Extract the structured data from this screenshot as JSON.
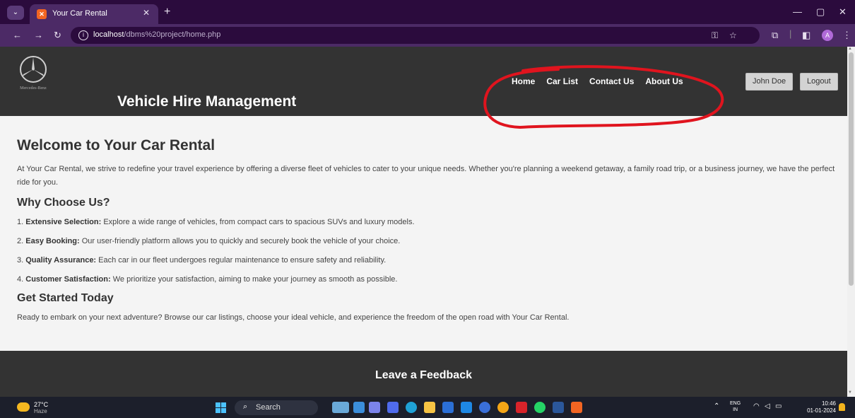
{
  "browser": {
    "tab_title": "Your Car Rental",
    "url_host": "localhost",
    "url_path": "/dbms%20project/home.php",
    "profile_initial": "A"
  },
  "header": {
    "logo_text": "Mercedes-Benz",
    "site_title": "Vehicle Hire Management",
    "nav": [
      "Home",
      "Car List",
      "Contact Us",
      "About Us"
    ],
    "user_button": "John Doe",
    "logout_button": "Logout",
    "annotation_color": "#e0141e"
  },
  "content": {
    "welcome_heading": "Welcome to Your Car Rental",
    "intro": "At Your Car Rental, we strive to redefine your travel experience by offering a diverse fleet of vehicles to cater to your unique needs. Whether you're planning a weekend getaway, a family road trip, or a business journey, we have the perfect ride for you.",
    "why_heading": "Why Choose Us?",
    "reasons": [
      {
        "num": "1.",
        "title": "Extensive Selection:",
        "text": "Explore a wide range of vehicles, from compact cars to spacious SUVs and luxury models."
      },
      {
        "num": "2.",
        "title": "Easy Booking:",
        "text": "Our user-friendly platform allows you to quickly and securely book the vehicle of your choice."
      },
      {
        "num": "3.",
        "title": "Quality Assurance:",
        "text": "Each car in our fleet undergoes regular maintenance to ensure safety and reliability."
      },
      {
        "num": "4.",
        "title": "Customer Satisfaction:",
        "text": "We prioritize your satisfaction, aiming to make your journey as smooth as possible."
      }
    ],
    "started_heading": "Get Started Today",
    "started_text": "Ready to embark on your next adventure? Browse our car listings, choose your ideal vehicle, and experience the freedom of the open road with Your Car Rental."
  },
  "feedback": {
    "title": "Leave a Feedback"
  },
  "taskbar": {
    "temperature": "27°C",
    "weather": "Haze",
    "search_label": "Search",
    "lang_top": "ENG",
    "lang_bottom": "IN",
    "time": "10:46",
    "date": "01-01-2024"
  },
  "colors": {
    "header_bg": "#333333",
    "browser_tabbar": "#2b0b3d",
    "browser_toolbar": "#4c2a66",
    "page_bg": "#f4f4f4"
  }
}
